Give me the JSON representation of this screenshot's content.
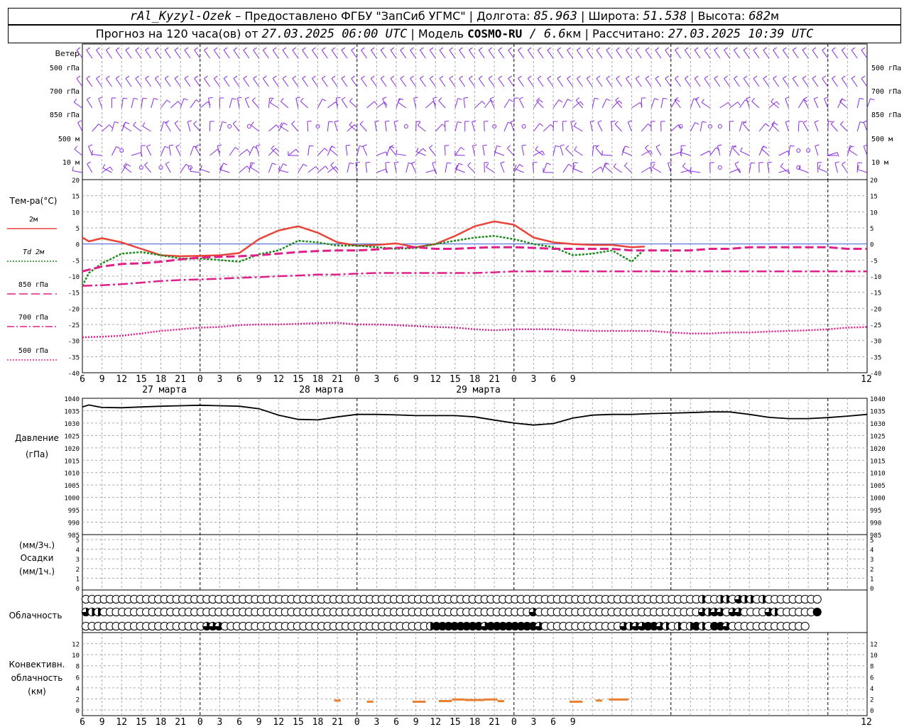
{
  "header": {
    "station": "rAl_Kyzyl-Ozek",
    "provider": " – Предоставлено ФГБУ \"ЗапСиб УГМС\" | Долгота: ",
    "lon": "85.963",
    "lat_label": " | Широта: ",
    "lat": "51.538",
    "alt_label": " | Высота: ",
    "alt": "682",
    "alt_unit": "м",
    "forecast_label": "Прогноз на 120 часа(ов) от ",
    "issued": "27.03.2025 06:00 UTC",
    "model_label": " | Модель ",
    "model": "COSMO-RU",
    "model_res": " / 6.6",
    "model_res_unit": "км",
    "computed_label": " | Рассчитано: ",
    "computed": "27.03.2025 10:39 UTC"
  },
  "panels": {
    "wind": {
      "title": "Ветер",
      "levels": [
        "500 гПа",
        "700 гПа",
        "850 гПа",
        "500 м",
        "10 м"
      ],
      "color": "#8a2be2"
    },
    "temperature": {
      "title": "Тем-ра(°С)",
      "ylim": [
        -40,
        20
      ],
      "ticks": [
        "20",
        "15",
        "10",
        "5",
        "0",
        "-5",
        "-10",
        "-15",
        "-20",
        "-25",
        "-30",
        "-35",
        "-40"
      ],
      "legend": [
        "2м",
        "Td  2м",
        "850 гПа",
        "700 гПа",
        "500 гПа"
      ]
    },
    "pressure": {
      "title": "Давление",
      "unit": "(гПа)",
      "ylim": [
        985,
        1040
      ],
      "ticks": [
        "1040",
        "1035",
        "1030",
        "1025",
        "1020",
        "1015",
        "1010",
        "1005",
        "1000",
        "995",
        "990",
        "985"
      ]
    },
    "precip": {
      "unit_top": "(мм/3ч.)",
      "title": "Осадки",
      "unit_bottom": "(мм/1ч.)",
      "ylim": [
        0,
        5
      ],
      "ticks": [
        "5",
        "4",
        "3",
        "2",
        "1",
        "0"
      ]
    },
    "cloud": {
      "title": "Облачность"
    },
    "convective": {
      "title1": "Конвективн.",
      "title2": "облачность",
      "unit": "(км)",
      "ylim": [
        0,
        14
      ],
      "ticks": [
        "12",
        "10",
        "8",
        "6",
        "4",
        "2",
        "0"
      ],
      "color": "#e87e2e"
    }
  },
  "time_axis": {
    "hour_labels": [
      "6",
      "9",
      "12",
      "15",
      "18",
      "21",
      "0",
      "3",
      "6",
      "9",
      "12",
      "15",
      "18",
      "21",
      "0",
      "3",
      "6",
      "9",
      "12",
      "15",
      "18",
      "21",
      "0",
      "3",
      "6",
      "9",
      "12"
    ],
    "day_labels": [
      {
        "text": "27 марта",
        "hour": 12
      },
      {
        "text": "28 марта",
        "hour": 36
      },
      {
        "text": "29 марта",
        "hour": 60
      }
    ]
  },
  "chart_data": {
    "type": "line",
    "x_unit": "hours from 27.03.2025 06:00 UTC",
    "temperature": {
      "series": [
        {
          "name": "2м",
          "color": "#e8443a",
          "style": "solid",
          "x": [
            0,
            1,
            3,
            6,
            9,
            12,
            15,
            18,
            21,
            24,
            27,
            30,
            33,
            36,
            39,
            42,
            45,
            48,
            51,
            54,
            57,
            60,
            63,
            66,
            69,
            72,
            75,
            78,
            81,
            84,
            86
          ],
          "y": [
            2,
            0.8,
            1.8,
            0.5,
            -1.5,
            -3.5,
            -3.8,
            -3.7,
            -3.5,
            -2.8,
            1.5,
            4.2,
            5.5,
            3.5,
            0.5,
            -0.5,
            -0.3,
            0.2,
            -1,
            0,
            2.5,
            5.5,
            7,
            6,
            2,
            0.5,
            0,
            -0.3,
            -0.3,
            -1,
            -0.8
          ]
        },
        {
          "name": "Td  2м",
          "color": "#1a8a1a",
          "style": "dotted",
          "x": [
            0,
            1,
            3,
            6,
            9,
            12,
            15,
            18,
            21,
            24,
            27,
            30,
            33,
            36,
            39,
            42,
            45,
            48,
            51,
            54,
            57,
            60,
            63,
            66,
            69,
            72,
            75,
            78,
            81,
            84,
            86
          ],
          "y": [
            -13,
            -9,
            -6,
            -3,
            -2.5,
            -3.5,
            -4.5,
            -4.5,
            -5,
            -5.5,
            -3.2,
            -2,
            1,
            0.5,
            -0.5,
            -0.5,
            -1,
            -1.5,
            -1.2,
            0,
            1,
            2,
            2.5,
            1.5,
            0,
            -1,
            -3.5,
            -3,
            -2,
            -5.5,
            -1.5
          ]
        },
        {
          "name": "850 гПа",
          "color": "#e0208a",
          "style": "dashed",
          "x": [
            0,
            3,
            6,
            9,
            12,
            15,
            18,
            21,
            24,
            27,
            30,
            33,
            36,
            39,
            42,
            45,
            48,
            51,
            54,
            57,
            60,
            63,
            66,
            69,
            72,
            75,
            78,
            81,
            84,
            87,
            90,
            93,
            96,
            99,
            102,
            105,
            108,
            111,
            114,
            117,
            120
          ],
          "y": [
            -8.5,
            -7,
            -6.2,
            -6,
            -5.5,
            -4.8,
            -4.2,
            -4,
            -3.8,
            -3.5,
            -3,
            -2.5,
            -2.2,
            -2,
            -2,
            -1.7,
            -1.2,
            -1,
            -1.5,
            -1.5,
            -1.2,
            -1,
            -1,
            -1.2,
            -1.5,
            -1.5,
            -1.5,
            -1.5,
            -2,
            -2,
            -2,
            -2,
            -1.5,
            -1.5,
            -1,
            -1,
            -1,
            -1,
            -1,
            -1.5,
            -1.5
          ]
        },
        {
          "name": "700 гПа",
          "color": "#e0208a",
          "style": "dashdot",
          "x": [
            0,
            3,
            6,
            9,
            12,
            15,
            18,
            21,
            24,
            27,
            30,
            33,
            36,
            39,
            42,
            45,
            48,
            51,
            54,
            57,
            60,
            63,
            66,
            69,
            72,
            75,
            78,
            81,
            84,
            87,
            90,
            93,
            96,
            99,
            102,
            105,
            108,
            111,
            114,
            117,
            120
          ],
          "y": [
            -13,
            -12.8,
            -12.5,
            -12,
            -11.5,
            -11.2,
            -11,
            -10.8,
            -10.5,
            -10.3,
            -10,
            -9.8,
            -9.5,
            -9.5,
            -9.2,
            -9,
            -9,
            -9,
            -9,
            -9,
            -9,
            -8.8,
            -8.5,
            -8.5,
            -8.5,
            -8.5,
            -8.5,
            -8.5,
            -8.5,
            -8.5,
            -8.5,
            -8.5,
            -8.5,
            -8.5,
            -8.5,
            -8.5,
            -8.5,
            -8.5,
            -8.5,
            -8.5,
            -8.5
          ]
        },
        {
          "name": "500 гПа",
          "color": "#e0208a",
          "style": "finedot",
          "x": [
            0,
            3,
            6,
            9,
            12,
            15,
            18,
            21,
            24,
            27,
            30,
            33,
            36,
            39,
            42,
            45,
            48,
            51,
            54,
            57,
            60,
            63,
            66,
            69,
            72,
            75,
            78,
            81,
            84,
            87,
            90,
            93,
            96,
            99,
            102,
            105,
            108,
            111,
            114,
            117,
            120
          ],
          "y": [
            -29,
            -28.8,
            -28.5,
            -27.8,
            -27,
            -26.5,
            -26,
            -25.8,
            -25.2,
            -25,
            -25,
            -24.8,
            -24.6,
            -24.5,
            -25,
            -25,
            -25.2,
            -25.5,
            -25.8,
            -26,
            -26.5,
            -26.8,
            -26.5,
            -26.5,
            -26.5,
            -26.8,
            -27,
            -27,
            -27,
            -27,
            -27.5,
            -27.8,
            -27.8,
            -27.5,
            -27.5,
            -27.2,
            -27,
            -26.8,
            -26.5,
            -26,
            -25.8
          ]
        }
      ]
    },
    "pressure": {
      "name": "Давление",
      "x": [
        0,
        1,
        2,
        3,
        6,
        9,
        12,
        15,
        18,
        21,
        24,
        27,
        30,
        33,
        36,
        39,
        42,
        45,
        48,
        51,
        54,
        57,
        60,
        63,
        66,
        69,
        72,
        75,
        78,
        81,
        84,
        87,
        90,
        93,
        96,
        99,
        102,
        105,
        108,
        111,
        114,
        117,
        120
      ],
      "y": [
        1036.5,
        1037.3,
        1036.8,
        1036.3,
        1036.2,
        1036.5,
        1036.8,
        1037,
        1037.2,
        1037,
        1036.8,
        1035.8,
        1033.2,
        1031.5,
        1031.3,
        1032.5,
        1033.5,
        1033.5,
        1033.3,
        1033,
        1033,
        1033,
        1032.5,
        1031.2,
        1030,
        1029.2,
        1029.8,
        1032,
        1033.2,
        1033.5,
        1033.5,
        1033.8,
        1034,
        1034.2,
        1034.5,
        1034.5,
        1033.5,
        1032.3,
        1031.8,
        1031.8,
        1032.2,
        1032.8,
        1033.5
      ]
    },
    "precipitation": {
      "x": [],
      "y": []
    },
    "cloud_cover": {
      "rows": [
        "top",
        "middle",
        "bottom"
      ],
      "step_hours": 1,
      "coverage_eighths": [
        [
          0,
          0,
          0,
          0,
          0,
          0,
          0,
          0,
          0,
          0,
          0,
          0,
          0,
          0,
          0,
          0,
          0,
          0,
          0,
          0,
          0,
          0,
          0,
          0,
          0,
          0,
          0,
          0,
          0,
          0,
          0,
          0,
          0,
          0,
          0,
          0,
          0,
          0,
          0,
          0,
          0,
          0,
          0,
          0,
          0,
          0,
          0,
          0,
          0,
          0,
          0,
          0,
          0,
          0,
          0,
          0,
          0,
          0,
          0,
          0,
          0,
          0,
          0,
          0,
          0,
          0,
          0,
          0,
          0,
          0,
          0,
          0,
          0,
          0,
          0,
          0,
          0,
          0,
          0,
          0,
          0,
          0,
          0,
          0,
          0,
          0,
          0,
          0,
          0,
          0,
          0,
          0,
          0,
          0,
          0,
          0,
          0,
          0,
          0,
          0,
          0,
          0,
          4,
          0,
          0,
          4,
          4,
          0,
          6,
          4,
          4,
          0,
          4,
          0,
          0,
          0,
          0,
          0,
          0,
          0,
          0,
          0
        ],
        [
          6,
          4,
          4,
          0,
          0,
          0,
          0,
          0,
          0,
          0,
          0,
          0,
          0,
          0,
          0,
          0,
          0,
          0,
          0,
          0,
          0,
          0,
          0,
          0,
          0,
          0,
          0,
          0,
          0,
          0,
          0,
          0,
          0,
          0,
          0,
          0,
          0,
          0,
          0,
          0,
          0,
          0,
          0,
          0,
          0,
          0,
          0,
          0,
          0,
          0,
          0,
          0,
          0,
          0,
          0,
          0,
          0,
          0,
          0,
          0,
          0,
          0,
          0,
          0,
          0,
          0,
          0,
          0,
          0,
          0,
          0,
          0,
          0,
          0,
          6,
          0,
          0,
          0,
          0,
          0,
          0,
          0,
          0,
          0,
          0,
          0,
          0,
          0,
          0,
          0,
          0,
          0,
          0,
          0,
          0,
          0,
          0,
          0,
          0,
          0,
          0,
          0,
          6,
          4,
          6,
          6,
          0,
          6,
          6,
          0,
          0,
          0,
          0,
          6,
          4,
          0,
          0,
          0,
          0,
          0,
          0,
          8
        ],
        [
          0,
          0,
          0,
          0,
          0,
          0,
          0,
          0,
          0,
          0,
          0,
          0,
          0,
          0,
          0,
          0,
          0,
          0,
          0,
          0,
          6,
          6,
          6,
          0,
          0,
          0,
          0,
          0,
          0,
          0,
          0,
          0,
          0,
          0,
          0,
          0,
          0,
          0,
          0,
          0,
          0,
          0,
          0,
          0,
          0,
          0,
          0,
          0,
          0,
          0,
          0,
          0,
          0,
          0,
          0,
          0,
          0,
          4,
          8,
          8,
          8,
          8,
          8,
          8,
          8,
          8,
          6,
          8,
          8,
          8,
          8,
          8,
          8,
          8,
          8,
          6,
          0,
          0,
          0,
          0,
          0,
          0,
          0,
          0,
          0,
          0,
          0,
          0,
          0,
          6,
          4,
          6,
          6,
          8,
          8,
          6,
          4,
          0,
          4,
          0,
          4,
          8,
          4,
          0,
          8,
          8,
          6,
          0,
          0,
          0,
          0,
          0,
          0,
          0,
          0,
          0,
          0,
          0,
          0,
          0
        ]
      ]
    },
    "convective_cloud": {
      "unit": "км",
      "segments": [
        {
          "x0": 38.5,
          "x1": 39.5,
          "y": 1.7
        },
        {
          "x0": 43.5,
          "x1": 44.5,
          "y": 1.5
        },
        {
          "x0": 50.5,
          "x1": 52.5,
          "y": 1.5
        },
        {
          "x0": 54.5,
          "x1": 56.5,
          "y": 1.6
        },
        {
          "x0": 56.5,
          "x1": 58.5,
          "y": 1.9
        },
        {
          "x0": 58.5,
          "x1": 61.5,
          "y": 1.8
        },
        {
          "x0": 61.5,
          "x1": 63.5,
          "y": 1.9
        },
        {
          "x0": 63.5,
          "x1": 64.5,
          "y": 1.6
        },
        {
          "x0": 74.5,
          "x1": 76.5,
          "y": 1.5
        },
        {
          "x0": 78.5,
          "x1": 79.5,
          "y": 1.7
        },
        {
          "x0": 80.5,
          "x1": 83.5,
          "y": 1.9
        }
      ]
    }
  }
}
